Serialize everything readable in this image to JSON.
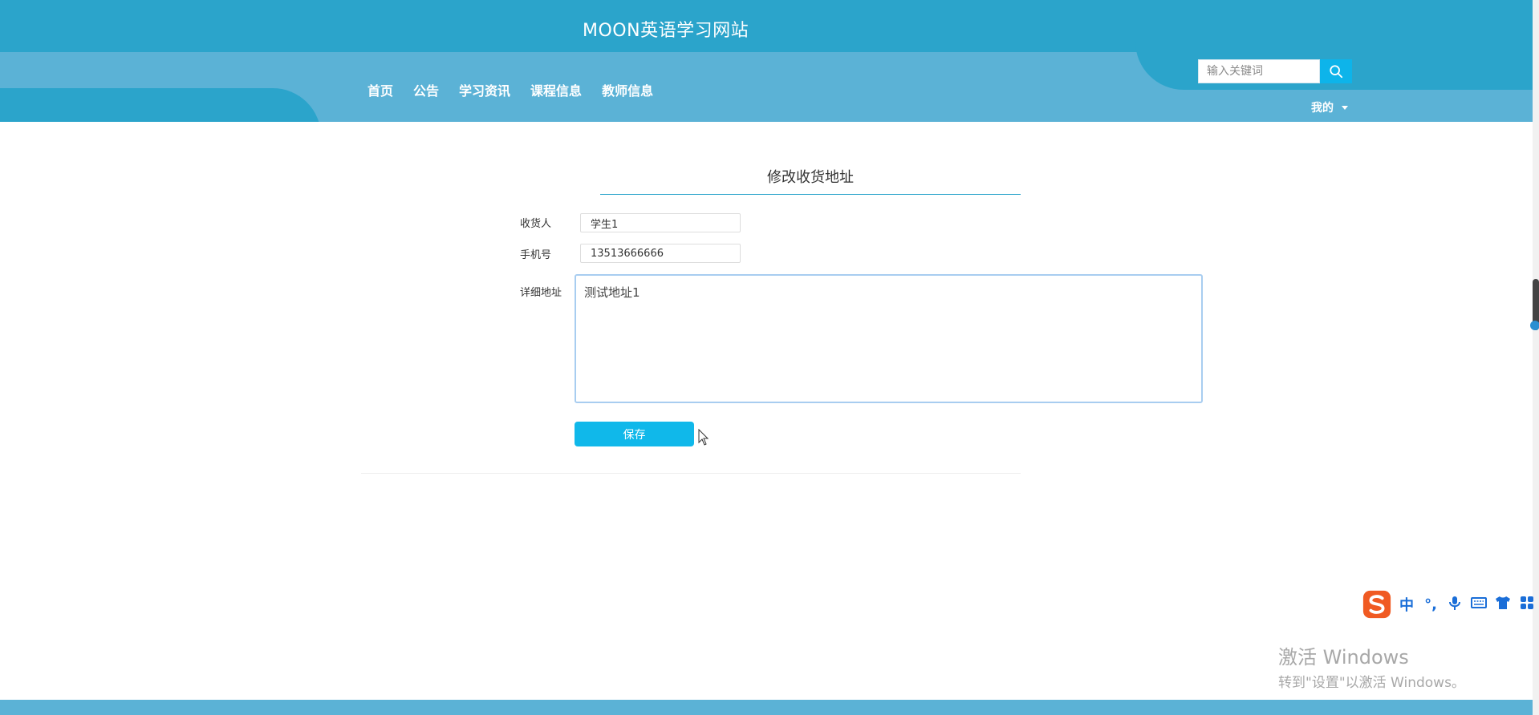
{
  "header": {
    "site_title": "MOON英语学习网站",
    "nav": [
      "首页",
      "公告",
      "学习资讯",
      "课程信息",
      "教师信息"
    ],
    "search_placeholder": "输入关键词",
    "my_menu_label": "我的"
  },
  "form": {
    "title": "修改收货地址",
    "fields": {
      "recipient_label": "收货人",
      "recipient_value": "学生1",
      "phone_label": "手机号",
      "phone_value": "13513666666",
      "address_label": "详细地址",
      "address_value": "测试地址1"
    },
    "save_label": "保存"
  },
  "ime": {
    "items": [
      "中",
      "°,"
    ]
  },
  "watermark": {
    "line1": "激活 Windows",
    "line2": "转到\"设置\"以激活 Windows。"
  },
  "colors": {
    "header_dark": "#2ba4cb",
    "header_light": "#5bb2d6",
    "accent": "#10b8ea"
  },
  "icons": [
    "search-icon",
    "caret-down-icon",
    "mouse-cursor-icon",
    "sogou-logo-icon",
    "microphone-icon",
    "keyboard-icon",
    "shirt-icon",
    "grid-icon"
  ]
}
